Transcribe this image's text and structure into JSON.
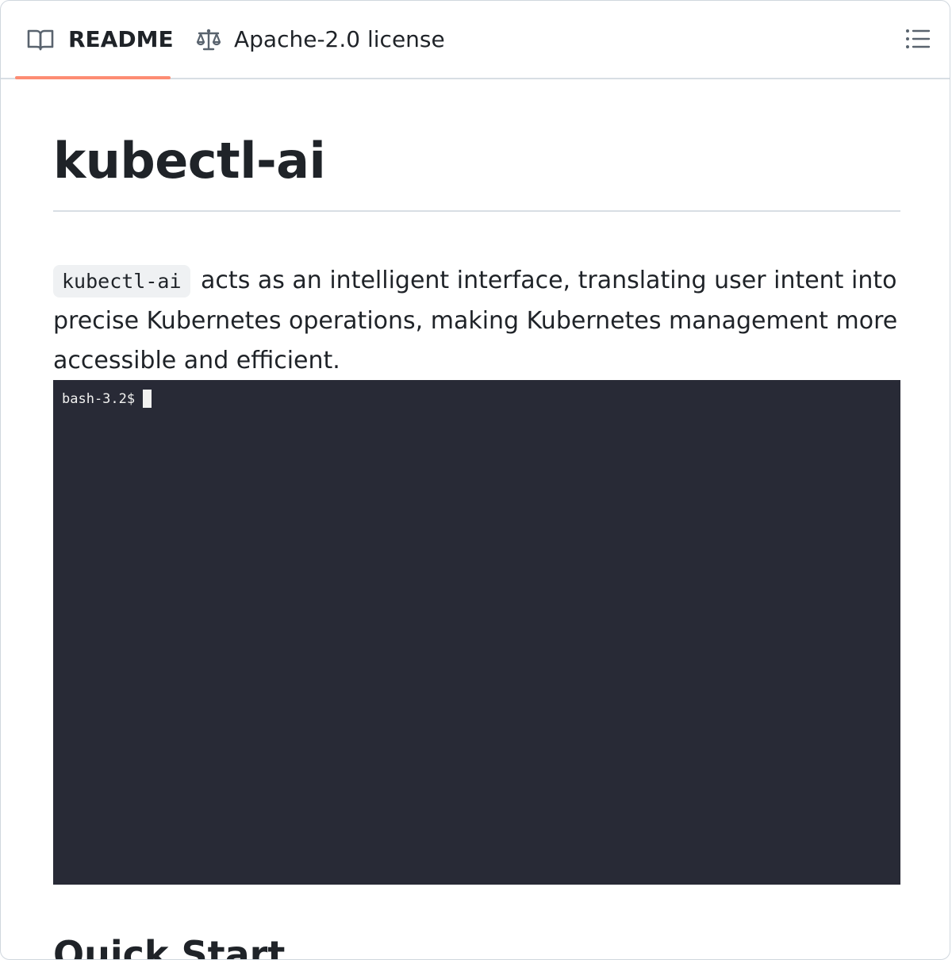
{
  "tabs": {
    "readme_label": "README",
    "license_label": "Apache-2.0 license",
    "active_underline_color": "#fd8c73",
    "icons": {
      "readme": "book-icon",
      "license": "law-scale-icon",
      "toc": "list-unordered-icon"
    }
  },
  "article": {
    "title": "kubectl-ai",
    "intro_code": "kubectl-ai",
    "intro_text": " acts as an intelligent interface, translating user intent into precise Kubernetes operations, making Kubernetes management more accessible and efficient.",
    "terminal": {
      "prompt": "bash-3.2$",
      "background": "#282a36"
    },
    "section_heading": "Quick Start"
  }
}
